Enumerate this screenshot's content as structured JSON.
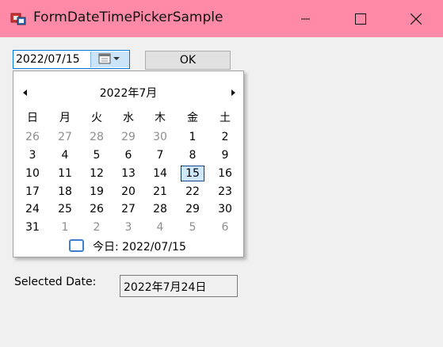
{
  "window": {
    "title": "FormDateTimePickerSample",
    "title_bar_color": "#ff8aa8",
    "controls": [
      "minimize-icon",
      "maximize-icon",
      "close-icon"
    ]
  },
  "date_picker": {
    "value": "2022/07/15",
    "dropdown_icon": "calendar-icon"
  },
  "ok_button": {
    "label": "OK"
  },
  "calendar": {
    "month_title": "2022年7月",
    "weekdays": [
      "日",
      "月",
      "火",
      "水",
      "木",
      "金",
      "土"
    ],
    "weeks": [
      [
        "26",
        "27",
        "28",
        "29",
        "30",
        "1",
        "2"
      ],
      [
        "3",
        "4",
        "5",
        "6",
        "7",
        "8",
        "9"
      ],
      [
        "10",
        "11",
        "12",
        "13",
        "14",
        "15",
        "16"
      ],
      [
        "17",
        "18",
        "19",
        "20",
        "21",
        "22",
        "23"
      ],
      [
        "24",
        "25",
        "26",
        "27",
        "28",
        "29",
        "30"
      ],
      [
        "31",
        "1",
        "2",
        "3",
        "4",
        "5",
        "6"
      ]
    ],
    "selected_day": "15",
    "today_label": "今日: 2022/07/15",
    "selection_color": "#cde8ff"
  },
  "selected_date": {
    "label": "Selected Date:",
    "value": "2022年7月24日"
  }
}
